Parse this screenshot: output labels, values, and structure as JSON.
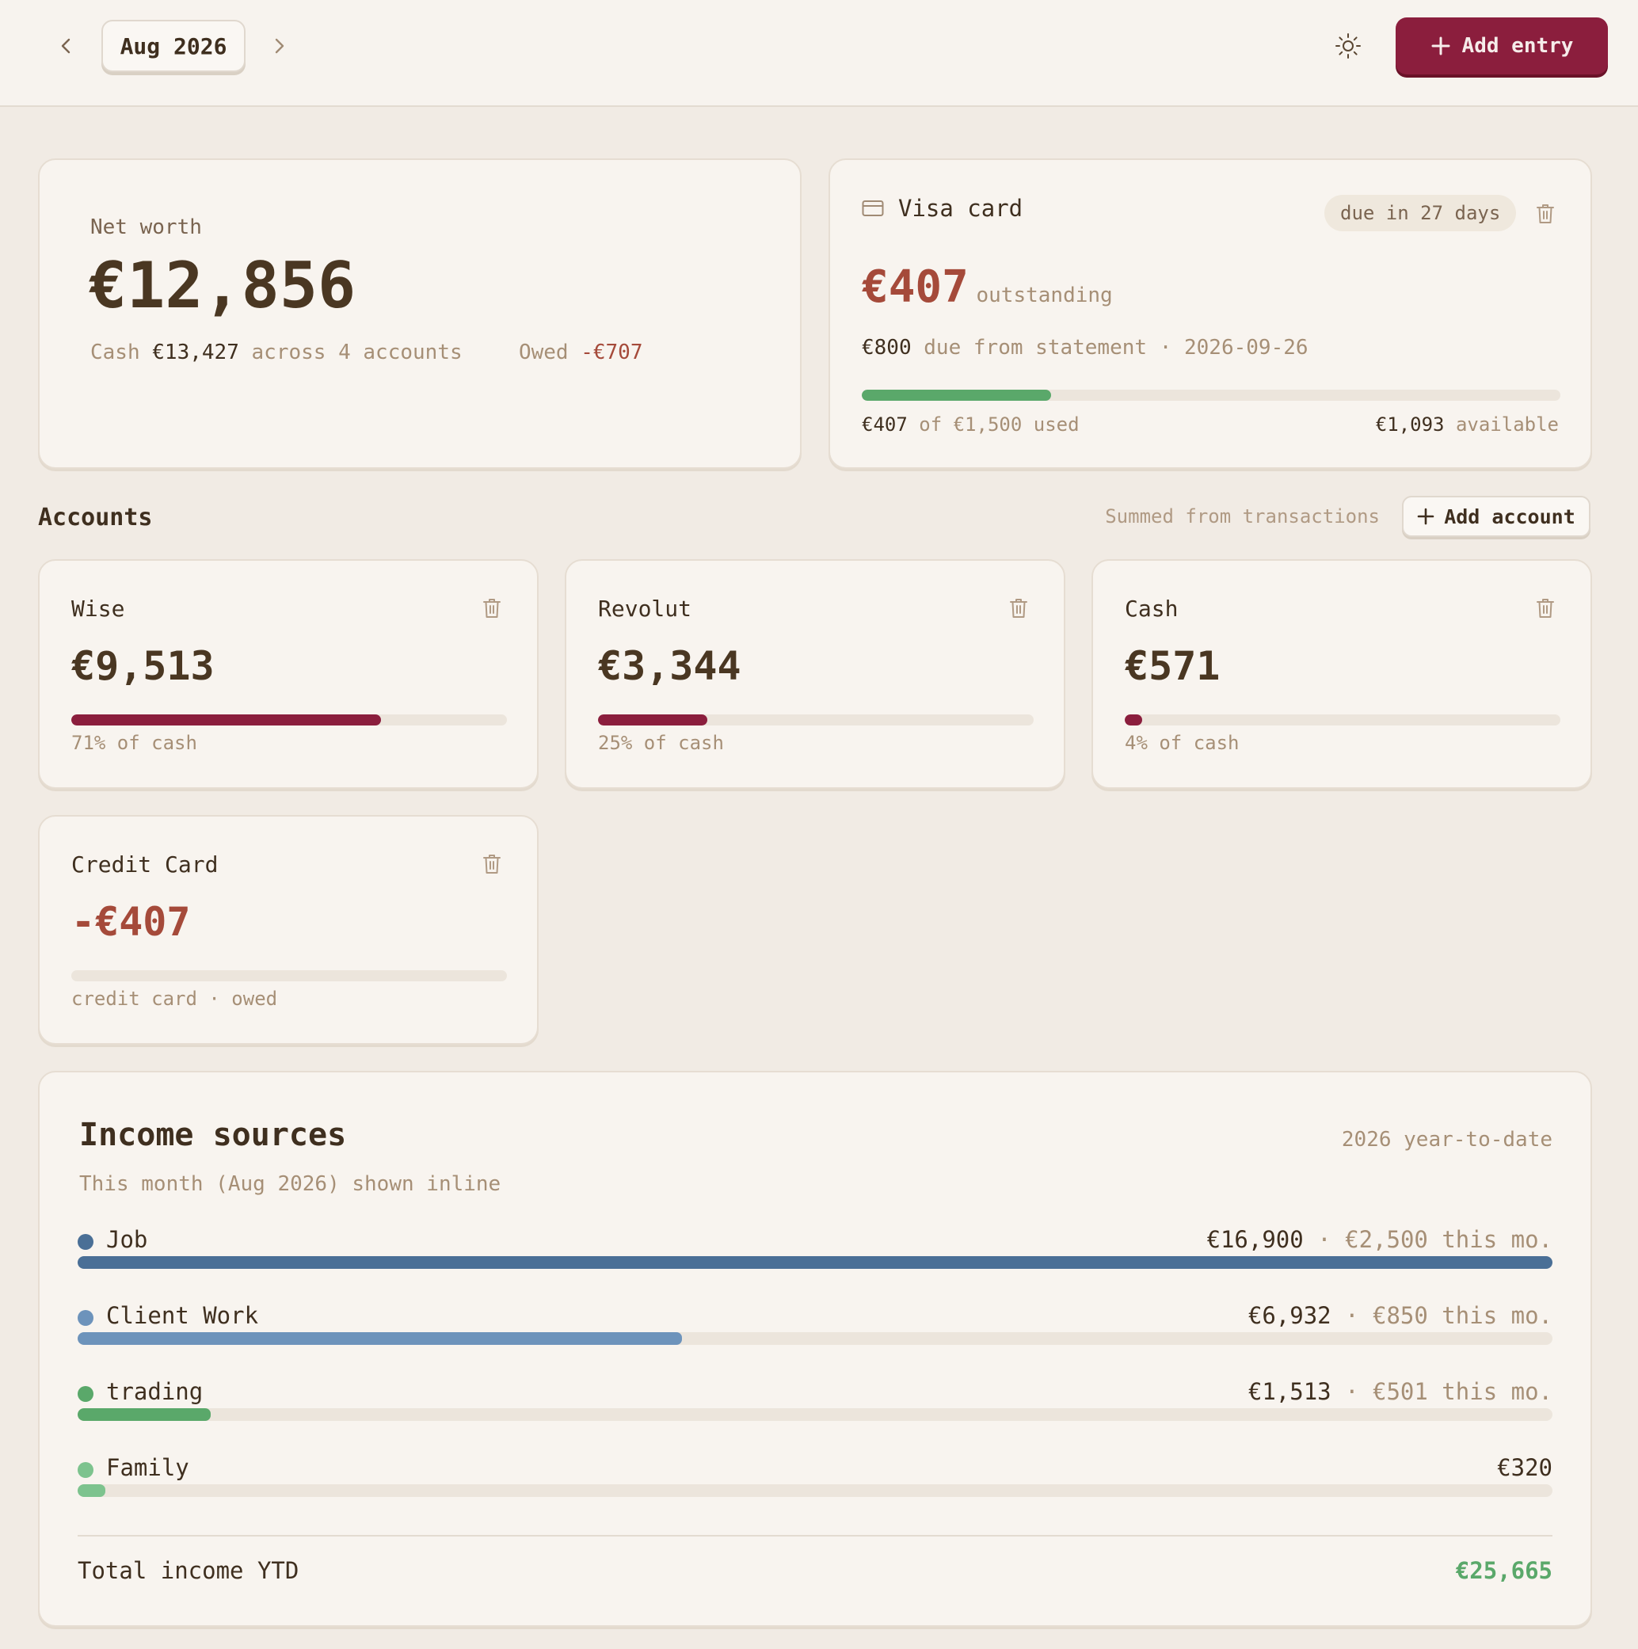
{
  "header": {
    "month": "Aug 2026",
    "add_entry": "Add entry"
  },
  "net_worth": {
    "label": "Net worth",
    "value": "€12,856",
    "cash_label": "Cash",
    "cash_value": "€13,427",
    "cash_suffix": "across 4 accounts",
    "owed_label": "Owed",
    "owed_value": "-€707"
  },
  "visa": {
    "title": "Visa card",
    "due_badge": "due in 27 days",
    "outstanding_value": "€407",
    "outstanding_label": "outstanding",
    "due_amount": "€800",
    "due_text": "due from statement · 2026-09-26",
    "used_value": "€407",
    "used_text": "of €1,500 used",
    "available_value": "€1,093",
    "available_text": "available",
    "used_fraction": 0.271,
    "bar_color": "#5aa86a"
  },
  "accounts": {
    "title": "Accounts",
    "note": "Summed from transactions",
    "add_label": "Add account",
    "items": [
      {
        "name": "Wise",
        "amount": "€9,513",
        "sub": "71% of cash",
        "fraction": 0.71,
        "color": "#8b1e3d"
      },
      {
        "name": "Revolut",
        "amount": "€3,344",
        "sub": "25% of cash",
        "fraction": 0.25,
        "color": "#8b1e3d"
      },
      {
        "name": "Cash",
        "amount": "€571",
        "sub": "4% of cash",
        "fraction": 0.04,
        "color": "#8b1e3d"
      },
      {
        "name": "Credit Card",
        "amount": "-€407",
        "sub": "credit card · owed",
        "fraction": 0,
        "color": "#8b1e3d"
      }
    ]
  },
  "income": {
    "title": "Income sources",
    "period": "2026 year-to-date",
    "subtitle": "This month (Aug 2026) shown inline",
    "sources": [
      {
        "name": "Job",
        "ytd": "€16,900",
        "month": "· €2,500 this mo.",
        "fraction": 1.0,
        "color": "#4a6f96"
      },
      {
        "name": "Client Work",
        "ytd": "€6,932",
        "month": "· €850 this mo.",
        "fraction": 0.41,
        "color": "#6d93bb"
      },
      {
        "name": "trading",
        "ytd": "€1,513",
        "month": "· €501 this mo.",
        "fraction": 0.09,
        "color": "#5aa86a"
      },
      {
        "name": "Family",
        "ytd": "€320",
        "month": "",
        "fraction": 0.019,
        "color": "#7dc38e"
      }
    ],
    "total_label": "Total income YTD",
    "total_value": "€25,665",
    "total_color": "#5aa86a"
  }
}
